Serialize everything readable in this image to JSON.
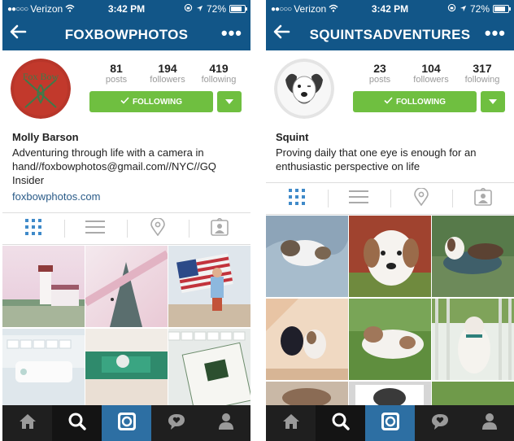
{
  "status_bar": {
    "left": {
      "carrier": "Verizon",
      "time": "3:42 PM",
      "battery": "72%",
      "battery_level": 0.72
    },
    "right": {
      "carrier": "Verizon",
      "time": "3:42 PM",
      "battery": "72%",
      "battery_level": 0.72
    }
  },
  "profiles": {
    "left": {
      "username": "FOXBOWPHOTOS",
      "avatar_text": "Fox Bow",
      "stats": {
        "posts": "81",
        "posts_label": "posts",
        "followers": "194",
        "followers_label": "followers",
        "following": "419",
        "following_label": "following"
      },
      "follow_label": "FOLLOWING",
      "name": "Molly Barson",
      "bio": "Adventuring through life with a camera in hand//foxbowphotos@gmail.com//NYC//GQ Insider",
      "website": "foxbowphotos.com"
    },
    "right": {
      "username": "SQUINTSADVENTURES",
      "stats": {
        "posts": "23",
        "posts_label": "posts",
        "followers": "104",
        "followers_label": "followers",
        "following": "317",
        "following_label": "following"
      },
      "follow_label": "FOLLOWING",
      "name": "Squint",
      "bio": "Proving daily that one eye is enough for an enthusiastic perspective on life"
    }
  },
  "colors": {
    "header": "#125688",
    "follow": "#6fbf40",
    "tab_active": "#2d6fa3",
    "tab_bar": "#1f1f1f"
  },
  "view_tabs": [
    "grid-icon",
    "list-icon",
    "location-pin-icon",
    "tagged-icon"
  ],
  "bottom_nav": [
    "home-icon",
    "search-icon",
    "camera-icon",
    "activity-icon",
    "profile-icon"
  ]
}
